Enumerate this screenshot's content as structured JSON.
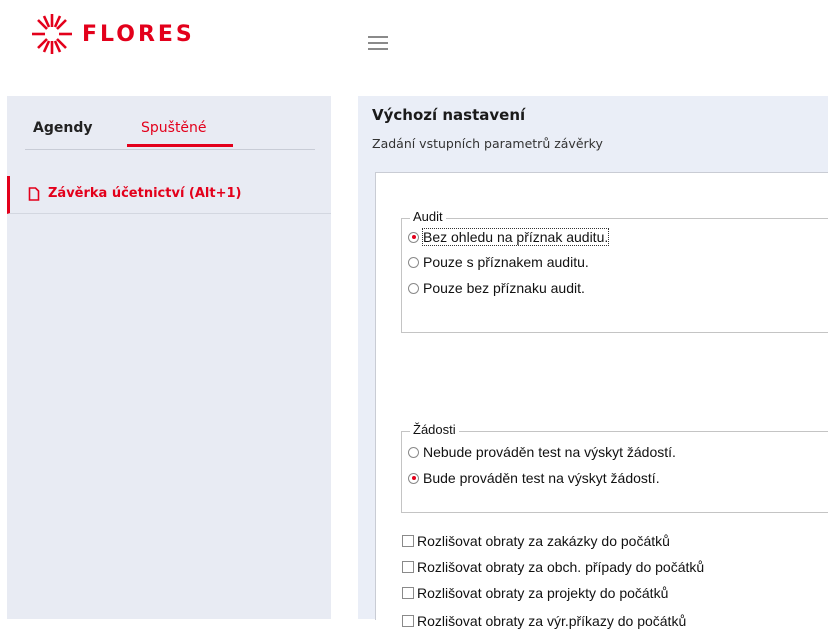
{
  "brand": {
    "name": "FLORES",
    "color": "#e3001b"
  },
  "header": {
    "menu_icon": "hamburger-icon"
  },
  "sidebar": {
    "tabs": [
      {
        "label": "Agendy",
        "active": false
      },
      {
        "label": "Spuštěné",
        "active": true
      }
    ],
    "items": [
      {
        "label": "Závěrka účetnictví (Alt+1)",
        "icon": "document-icon"
      }
    ]
  },
  "main": {
    "title": "Výchozí nastavení",
    "subtitle": "Zadání vstupních parametrů závěrky",
    "groups": [
      {
        "legend": "Audit",
        "options": [
          {
            "label": "Bez ohledu na příznak auditu.",
            "selected": true
          },
          {
            "label": "Pouze s příznakem auditu.",
            "selected": false
          },
          {
            "label": "Pouze bez příznaku audit.",
            "selected": false
          }
        ]
      },
      {
        "legend": "Žádosti",
        "options": [
          {
            "label": "Nebude prováděn test na výskyt žádostí.",
            "selected": false
          },
          {
            "label": "Bude prováděn test na výskyt žádostí.",
            "selected": true
          }
        ]
      }
    ],
    "checkboxes": [
      {
        "label": "Rozlišovat obraty za zakázky do počátků",
        "checked": false
      },
      {
        "label": "Rozlišovat obraty za obch. případy do počátků",
        "checked": false
      },
      {
        "label": "Rozlišovat obraty za projekty do počátků",
        "checked": false
      },
      {
        "label": "Rozlišovat obraty za výr.příkazy do počátků",
        "checked": false
      }
    ]
  }
}
